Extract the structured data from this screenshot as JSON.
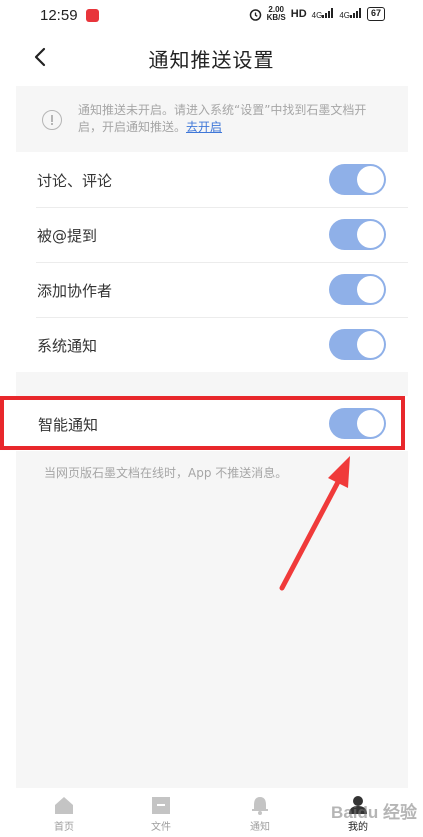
{
  "status_bar": {
    "time": "12:59",
    "speed_top": "2.00",
    "speed_bottom": "KB/S",
    "hd": "HD",
    "signal_1": "4G",
    "signal_2": "4G",
    "battery": "67"
  },
  "nav": {
    "title": "通知推送设置"
  },
  "notice": {
    "text": "通知推送未开启。请进入系统“设置”中找到石墨文档开启，开启通知推送。",
    "link": "去开启"
  },
  "settings": {
    "items": [
      {
        "label": "讨论、评论",
        "enabled": true
      },
      {
        "label": "被@提到",
        "enabled": true
      },
      {
        "label": "添加协作者",
        "enabled": true
      },
      {
        "label": "系统通知",
        "enabled": true
      }
    ],
    "smart": {
      "label": "智能通知",
      "enabled": true
    },
    "smart_desc": "当网页版石墨文档在线时，App 不推送消息。"
  },
  "tabs": [
    {
      "label": "首页",
      "icon": "home-icon",
      "active": false
    },
    {
      "label": "文件",
      "icon": "folder-icon",
      "active": false
    },
    {
      "label": "通知",
      "icon": "bell-icon",
      "active": false
    },
    {
      "label": "我的",
      "icon": "user-icon",
      "active": true
    }
  ],
  "watermark": "Baidu 经验",
  "colors": {
    "toggle_on": "#8fb0e8",
    "link": "#3f77d8",
    "highlight": "#e8272b"
  }
}
